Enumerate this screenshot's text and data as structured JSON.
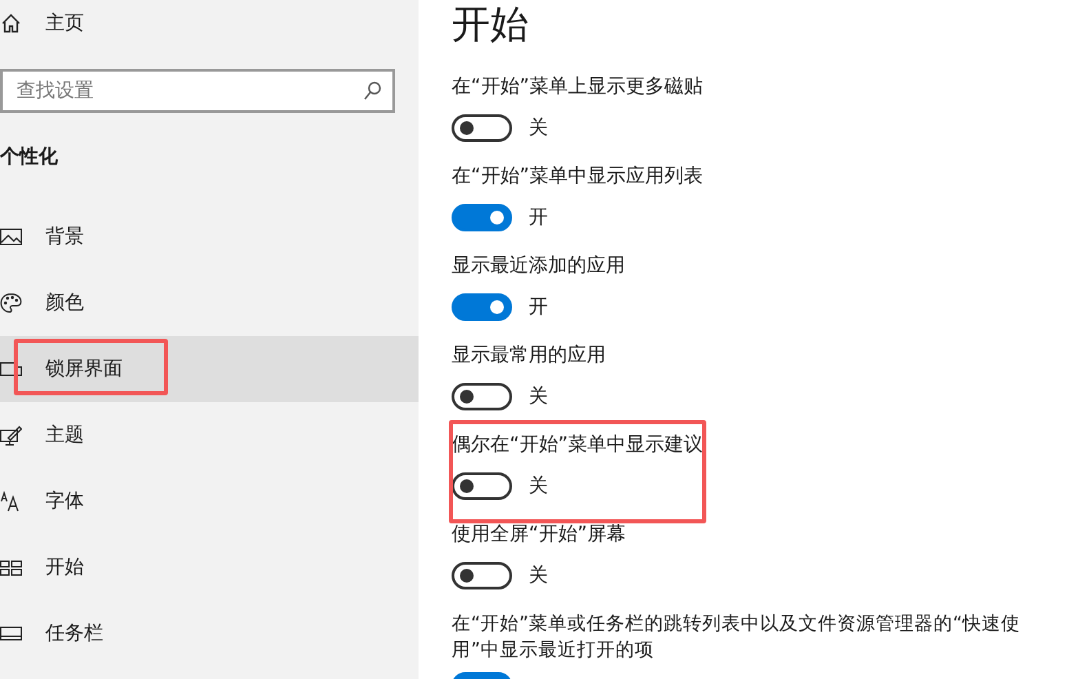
{
  "sidebar": {
    "home": {
      "label": "主页"
    },
    "search": {
      "placeholder": "查找设置"
    },
    "section_title": "个性化",
    "items": [
      {
        "label": "背景",
        "selected": false,
        "highlighted": false
      },
      {
        "label": "颜色",
        "selected": false,
        "highlighted": false
      },
      {
        "label": "锁屏界面",
        "selected": true,
        "highlighted": true
      },
      {
        "label": "主题",
        "selected": false,
        "highlighted": false
      },
      {
        "label": "字体",
        "selected": false,
        "highlighted": false
      },
      {
        "label": "开始",
        "selected": false,
        "highlighted": false
      },
      {
        "label": "任务栏",
        "selected": false,
        "highlighted": false
      }
    ]
  },
  "page": {
    "title": "开始",
    "settings": [
      {
        "label": "在“开始”菜单上显示更多磁贴",
        "on": false,
        "state_text": "关",
        "highlighted": false
      },
      {
        "label": "在“开始”菜单中显示应用列表",
        "on": true,
        "state_text": "开",
        "highlighted": false
      },
      {
        "label": "显示最近添加的应用",
        "on": true,
        "state_text": "开",
        "highlighted": false
      },
      {
        "label": "显示最常用的应用",
        "on": false,
        "state_text": "关",
        "highlighted": false
      },
      {
        "label": "偶尔在“开始”菜单中显示建议",
        "on": false,
        "state_text": "关",
        "highlighted": true
      },
      {
        "label": "使用全屏“开始”屏幕",
        "on": false,
        "state_text": "关",
        "highlighted": false
      },
      {
        "label": "在“开始”菜单或任务栏的跳转列表中以及文件资源管理器的“快速使用”中显示最近打开的项",
        "on": true,
        "highlighted": false
      }
    ]
  }
}
